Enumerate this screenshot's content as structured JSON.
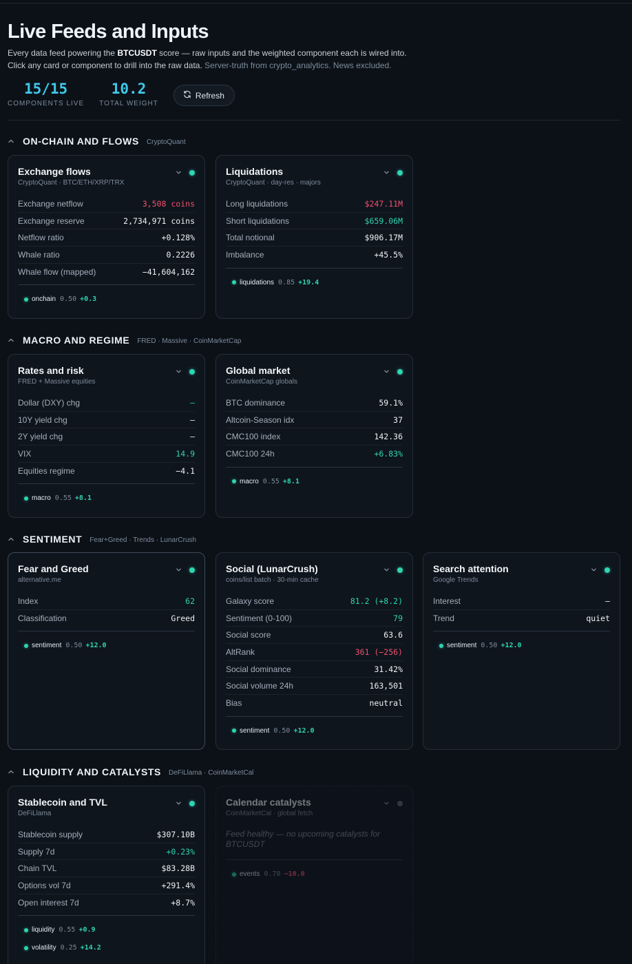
{
  "header": {
    "title": "Live Feeds and Inputs",
    "desc_prefix": "Every data feed powering the",
    "symbol": "BTCUSDT",
    "desc_suffix": "score — raw inputs and the weighted component each is wired into.",
    "desc_line2": "Click any card or component to drill into the raw data.",
    "desc_note": "Server-truth from crypto_analytics. News excluded."
  },
  "stats": {
    "components_live": "15/15",
    "components_live_label": "COMPONENTS LIVE",
    "total_weight": "10.2",
    "total_weight_label": "TOTAL WEIGHT",
    "refresh_label": "Refresh"
  },
  "colors": {
    "accent": "#40c8e8",
    "positive": "#2fd4b1",
    "negative": "#f0506e",
    "background": "#0c1118",
    "card": "#0f151d"
  },
  "sections": {
    "onchain": {
      "title": "ON-CHAIN AND FLOWS",
      "source": "CryptoQuant"
    },
    "macro": {
      "title": "MACRO AND REGIME",
      "source": "FRED · Massive · CoinMarketCap"
    },
    "sentiment": {
      "title": "SENTIMENT",
      "source": "Fear+Greed · Trends · LunarCrush"
    },
    "liquidity": {
      "title": "LIQUIDITY AND CATALYSTS",
      "source": "DeFiLlama · CoinMarketCal"
    }
  },
  "cards": {
    "exchange_flows": {
      "title": "Exchange flows",
      "subtitle": "CryptoQuant · BTC/ETH/XRP/TRX",
      "status": "live",
      "rows": [
        {
          "label": "Exchange netflow",
          "value": "3,508 coins",
          "tone": "red"
        },
        {
          "label": "Exchange reserve",
          "value": "2,734,971 coins",
          "tone": ""
        },
        {
          "label": "Netflow ratio",
          "value": "+0.128%",
          "tone": ""
        },
        {
          "label": "Whale ratio",
          "value": "0.2226",
          "tone": ""
        },
        {
          "label": "Whale flow (mapped)",
          "value": "−41,604,162",
          "tone": ""
        }
      ],
      "chips": [
        {
          "name": "onchain",
          "weight": "0.50",
          "delta": "+0.3",
          "tone": "pos"
        }
      ]
    },
    "liquidations": {
      "title": "Liquidations",
      "subtitle": "CryptoQuant · day-res · majors",
      "status": "live",
      "rows": [
        {
          "label": "Long liquidations",
          "value": "$247.11M",
          "tone": "red"
        },
        {
          "label": "Short liquidations",
          "value": "$659.06M",
          "tone": "green"
        },
        {
          "label": "Total notional",
          "value": "$906.17M",
          "tone": ""
        },
        {
          "label": "Imbalance",
          "value": "+45.5%",
          "tone": ""
        }
      ],
      "chips": [
        {
          "name": "liquidations",
          "weight": "0.85",
          "delta": "+19.4",
          "tone": "pos"
        }
      ]
    },
    "rates_risk": {
      "title": "Rates and risk",
      "subtitle": "FRED + Massive equities",
      "status": "live",
      "rows": [
        {
          "label": "Dollar (DXY) chg",
          "value": "—",
          "tone": "green"
        },
        {
          "label": "10Y yield chg",
          "value": "—",
          "tone": ""
        },
        {
          "label": "2Y yield chg",
          "value": "—",
          "tone": ""
        },
        {
          "label": "VIX",
          "value": "14.9",
          "tone": "green"
        },
        {
          "label": "Equities regime",
          "value": "−4.1",
          "tone": ""
        }
      ],
      "chips": [
        {
          "name": "macro",
          "weight": "0.55",
          "delta": "+8.1",
          "tone": "pos"
        }
      ]
    },
    "global_market": {
      "title": "Global market",
      "subtitle": "CoinMarketCap globals",
      "status": "live",
      "rows": [
        {
          "label": "BTC dominance",
          "value": "59.1%",
          "tone": ""
        },
        {
          "label": "Altcoin-Season idx",
          "value": "37",
          "tone": ""
        },
        {
          "label": "CMC100 index",
          "value": "142.36",
          "tone": ""
        },
        {
          "label": "CMC100 24h",
          "value": "+6.83%",
          "tone": "green"
        }
      ],
      "chips": [
        {
          "name": "macro",
          "weight": "0.55",
          "delta": "+8.1",
          "tone": "pos"
        }
      ]
    },
    "fear_greed": {
      "title": "Fear and Greed",
      "subtitle": "alternative.me",
      "status": "live",
      "rows": [
        {
          "label": "Index",
          "value": "62",
          "tone": "green"
        },
        {
          "label": "Classification",
          "value": "Greed",
          "tone": ""
        }
      ],
      "chips": [
        {
          "name": "sentiment",
          "weight": "0.50",
          "delta": "+12.0",
          "tone": "pos"
        }
      ]
    },
    "social": {
      "title": "Social (LunarCrush)",
      "subtitle": "coins/list batch · 30-min cache",
      "status": "live",
      "rows": [
        {
          "label": "Galaxy score",
          "value": "81.2 (+8.2)",
          "tone": "green"
        },
        {
          "label": "Sentiment (0-100)",
          "value": "79",
          "tone": "green"
        },
        {
          "label": "Social score",
          "value": "63.6",
          "tone": ""
        },
        {
          "label": "AltRank",
          "value": "361 (−256)",
          "tone": "red"
        },
        {
          "label": "Social dominance",
          "value": "31.42%",
          "tone": ""
        },
        {
          "label": "Social volume 24h",
          "value": "163,501",
          "tone": ""
        },
        {
          "label": "Bias",
          "value": "neutral",
          "tone": ""
        }
      ],
      "chips": [
        {
          "name": "sentiment",
          "weight": "0.50",
          "delta": "+12.0",
          "tone": "pos"
        }
      ]
    },
    "search_attention": {
      "title": "Search attention",
      "subtitle": "Google Trends",
      "status": "live",
      "rows": [
        {
          "label": "Interest",
          "value": "—",
          "tone": ""
        },
        {
          "label": "Trend",
          "value": "quiet",
          "tone": ""
        }
      ],
      "chips": [
        {
          "name": "sentiment",
          "weight": "0.50",
          "delta": "+12.0",
          "tone": "pos"
        }
      ]
    },
    "stablecoin_tvl": {
      "title": "Stablecoin and TVL",
      "subtitle": "DeFiLlama",
      "status": "live",
      "rows": [
        {
          "label": "Stablecoin supply",
          "value": "$307.10B",
          "tone": ""
        },
        {
          "label": "Supply 7d",
          "value": "+0.23%",
          "tone": "green"
        },
        {
          "label": "Chain TVL",
          "value": "$83.28B",
          "tone": ""
        },
        {
          "label": "Options vol 7d",
          "value": "+291.4%",
          "tone": ""
        },
        {
          "label": "Open interest 7d",
          "value": "+8.7%",
          "tone": ""
        }
      ],
      "chips": [
        {
          "name": "liquidity",
          "weight": "0.55",
          "delta": "+0.9",
          "tone": "pos"
        },
        {
          "name": "volatility",
          "weight": "0.25",
          "delta": "+14.2",
          "tone": "pos"
        }
      ]
    },
    "calendar": {
      "title": "Calendar catalysts",
      "subtitle": "CoinMarketCal · global fetch",
      "status": "idle",
      "note": "Feed healthy — no upcoming catalysts for BTCUSDT",
      "chips": [
        {
          "name": "events",
          "weight": "0.70",
          "delta": "−10.0",
          "tone": "neg"
        }
      ]
    }
  }
}
